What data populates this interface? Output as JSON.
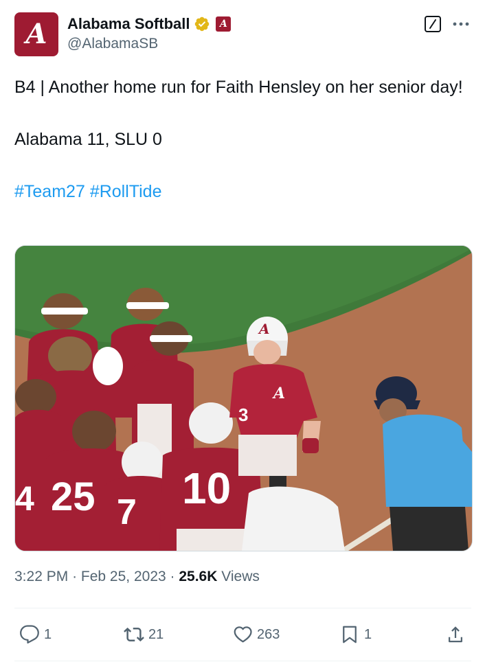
{
  "account": {
    "display_name": "Alabama Softball",
    "handle": "@AlabamaSB",
    "avatar_letter": "A",
    "brand_color": "#9e1b32",
    "verified_color": "#e2b719"
  },
  "tweet": {
    "line1": "B4 | Another home run for Faith Hensley on her senior day!",
    "line2": "Alabama 11, SLU 0",
    "hashtags": [
      "#Team27",
      "#RollTide"
    ]
  },
  "media": {
    "jersey_10": "10",
    "jersey_25": "25",
    "jersey_3": "3",
    "jersey_4": "4",
    "jersey_7": "7",
    "helmet_letter": "A"
  },
  "meta": {
    "time": "3:22 PM",
    "separator": "·",
    "date": "Feb 25, 2023",
    "views_count": "25.6K",
    "views_label": "Views"
  },
  "actions": {
    "replies": "1",
    "reposts": "21",
    "likes": "263",
    "bookmarks": "1"
  },
  "icons": {
    "verified": "verified-badge-icon",
    "affiliate": "affiliate-badge-icon",
    "grok": "grok-icon",
    "more": "more-icon",
    "reply": "reply-icon",
    "repost": "repost-icon",
    "like": "heart-icon",
    "bookmark": "bookmark-icon",
    "share": "share-icon"
  },
  "colors": {
    "link": "#1d9bf0",
    "secondary_text": "#536471",
    "umpire_shirt": "#4aa6e0",
    "field_grass": "#3f7a3a",
    "field_dirt": "#b27351"
  }
}
